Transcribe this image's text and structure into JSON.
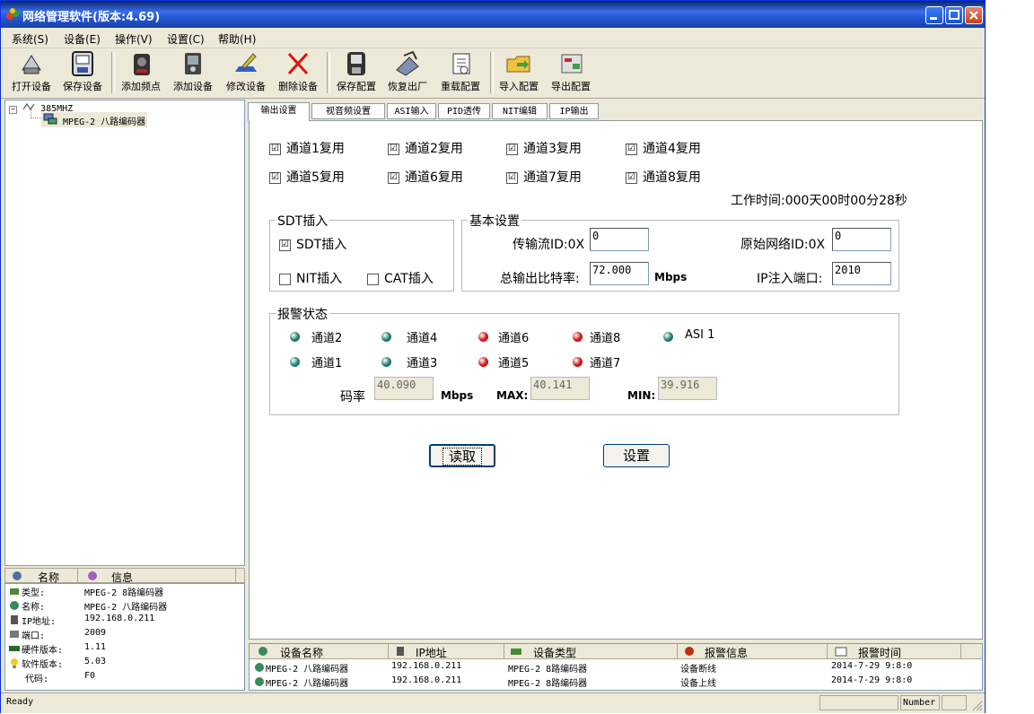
{
  "window": {
    "title": "网络管理软件(版本:4.69)"
  },
  "menu": [
    "系统(S)",
    "设备(E)",
    "操作(V)",
    "设置(C)",
    "帮助(H)"
  ],
  "toolbar": [
    {
      "label": "打开设备",
      "icon": "open-device-icon"
    },
    {
      "label": "保存设备",
      "icon": "save-device-icon"
    },
    {
      "label": "添加频点",
      "icon": "add-frequency-icon"
    },
    {
      "label": "添加设备",
      "icon": "add-device-icon"
    },
    {
      "label": "修改设备",
      "icon": "edit-device-icon"
    },
    {
      "label": "删除设备",
      "icon": "delete-device-icon"
    },
    {
      "label": "保存配置",
      "icon": "save-config-icon"
    },
    {
      "label": "恢复出厂",
      "icon": "factory-reset-icon"
    },
    {
      "label": "重载配置",
      "icon": "reload-config-icon"
    },
    {
      "label": "导入配置",
      "icon": "import-config-icon"
    },
    {
      "label": "导出配置",
      "icon": "export-config-icon"
    }
  ],
  "tree": {
    "root": "385MHZ",
    "child": "MPEG-2 八路编码器"
  },
  "info": {
    "col_name": "名称",
    "col_info": "信息",
    "rows": [
      {
        "key": "类型:",
        "value": "MPEG-2 8路编码器"
      },
      {
        "key": "名称:",
        "value": "MPEG-2 八路编码器"
      },
      {
        "key": "IP地址:",
        "value": "192.168.0.211"
      },
      {
        "key": "端口:",
        "value": "2009"
      },
      {
        "key": "硬件版本:",
        "value": "1.11"
      },
      {
        "key": "软件版本:",
        "value": "5.03"
      },
      {
        "key": "代码:",
        "value": "F0"
      }
    ]
  },
  "tabs": [
    "输出设置",
    "视音频设置",
    "ASI输入",
    "PID透传",
    "NIT编辑",
    "IP输出"
  ],
  "channels": [
    {
      "label": "通道1复用",
      "checked": "☑"
    },
    {
      "label": "通道2复用",
      "checked": "☑"
    },
    {
      "label": "通道3复用",
      "checked": "☑"
    },
    {
      "label": "通道4复用",
      "checked": "☑"
    },
    {
      "label": "通道5复用",
      "checked": "☑"
    },
    {
      "label": "通道6复用",
      "checked": "☑"
    },
    {
      "label": "通道7复用",
      "checked": "☑"
    },
    {
      "label": "通道8复用",
      "checked": "☑"
    }
  ],
  "work_time": "工作时间:000天00时00分28秒",
  "sdt_group": {
    "title": "SDT插入",
    "sdt": "SDT插入",
    "nit": "NIT插入",
    "cat": "CAT插入"
  },
  "basic": {
    "title": "基本设置",
    "ts_id_label": "传输流ID:0X",
    "ts_id": "0",
    "net_id_label": "原始网络ID:0X",
    "net_id": "0",
    "bitrate_label": "总输出比特率:",
    "bitrate": "72.000",
    "bitrate_unit": "Mbps",
    "ip_port_label": "IP注入端口:",
    "ip_port": "2010"
  },
  "alarm": {
    "title": "报警状态",
    "items": [
      {
        "label": "通道2",
        "color": "#1a7a6a"
      },
      {
        "label": "通道4",
        "color": "#1a7a6a"
      },
      {
        "label": "通道6",
        "color": "#cc1010"
      },
      {
        "label": "通道8",
        "color": "#cc1010"
      },
      {
        "label": "ASI 1",
        "color": "#1a7a6a"
      },
      {
        "label": "通道1",
        "color": "#1a7a6a"
      },
      {
        "label": "通道3",
        "color": "#1a7a6a"
      },
      {
        "label": "通道5",
        "color": "#cc1010"
      },
      {
        "label": "通道7",
        "color": "#cc1010"
      }
    ],
    "rate_label": "码率",
    "rate": "40.090",
    "rate_unit": "Mbps",
    "max_label": "MAX:",
    "max": "40.141",
    "min_label": "MIN:",
    "min": "39.916"
  },
  "buttons": {
    "read": "读取",
    "set": "设置"
  },
  "alarm_list": {
    "headers": [
      "设备名称",
      "IP地址",
      "设备类型",
      "报警信息",
      "报警时间"
    ],
    "rows": [
      [
        "MPEG-2 八路编码器",
        "192.168.0.211",
        "MPEG-2 8路编码器",
        "设备断线",
        "2014-7-29 9:8:0"
      ],
      [
        "MPEG-2 八路编码器",
        "192.168.0.211",
        "MPEG-2 8路编码器",
        "设备上线",
        "2014-7-29 9:8:0"
      ]
    ]
  },
  "status": {
    "text": "Ready",
    "num": "Number"
  }
}
